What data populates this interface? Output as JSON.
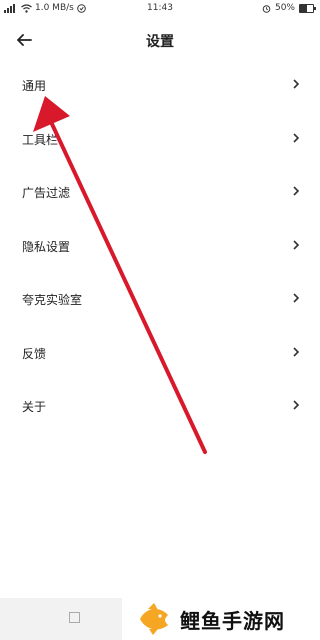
{
  "status_bar": {
    "network_speed": "1.0 MB/s",
    "time": "11:43",
    "battery": "50%",
    "battery_level": 0.5
  },
  "header": {
    "title": "设置"
  },
  "menu": {
    "items": [
      {
        "label": "通用"
      },
      {
        "label": "工具栏"
      },
      {
        "label": "广告过滤"
      },
      {
        "label": "隐私设置"
      },
      {
        "label": "夸克实验室"
      },
      {
        "label": "反馈"
      },
      {
        "label": "关于"
      }
    ]
  },
  "annotation": {
    "arrow_color": "#d8192b"
  },
  "watermark": {
    "text": "鲤鱼手游网",
    "fish_color": "#f5a623"
  },
  "icons": [
    "signal-icon",
    "wifi-icon",
    "back-arrow-icon",
    "chevron-right-icon",
    "alarm-icon",
    "battery-icon",
    "home-square-icon",
    "fish-logo-icon"
  ]
}
